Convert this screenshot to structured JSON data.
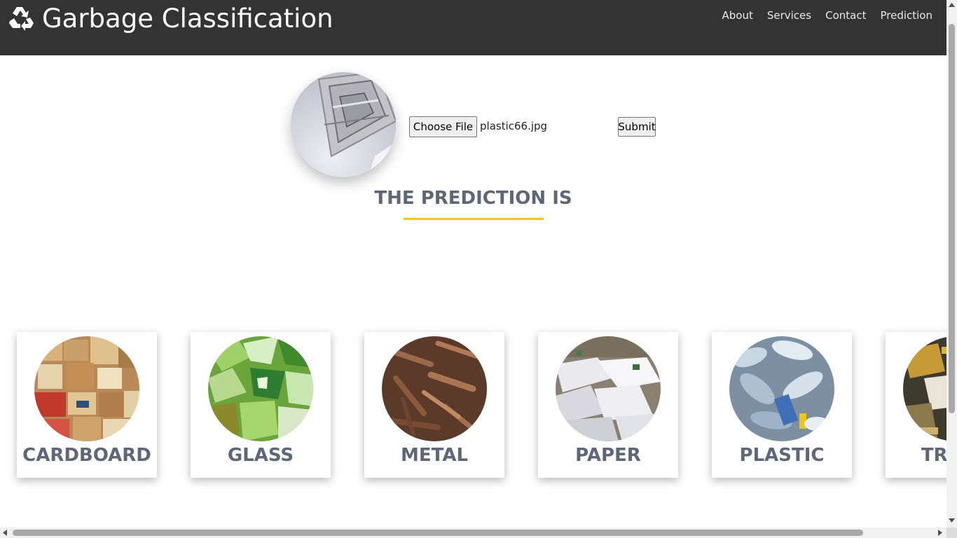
{
  "header": {
    "title": "Garbage Classification",
    "logo_icon": "recycle-icon",
    "nav": [
      "About",
      "Services",
      "Contact",
      "Prediction"
    ],
    "background": "#333333"
  },
  "upload": {
    "choose_label": "Choose File",
    "file_name": "plastic66.jpg",
    "submit_label": "Submit"
  },
  "prediction": {
    "heading": "THE PREDICTION IS",
    "accent": "#f5c518"
  },
  "categories": [
    {
      "label": "CARDBOARD"
    },
    {
      "label": "GLASS"
    },
    {
      "label": "METAL"
    },
    {
      "label": "PAPER"
    },
    {
      "label": "PLASTIC"
    },
    {
      "label": "TRASH"
    }
  ],
  "text_color": "#5d6778"
}
